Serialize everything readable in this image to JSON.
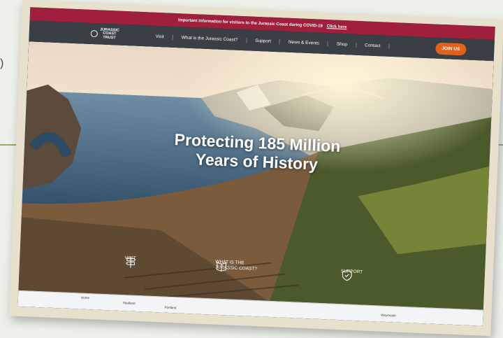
{
  "banner": {
    "notice": "Important information for visitors to the Jurassic Coast during COVID-19",
    "link": "Click here"
  },
  "logo": {
    "text": "JURASSIC\nCOAST\nTRUST"
  },
  "nav": {
    "items": [
      "Visit",
      "What is the Jurassic Coast?",
      "Support",
      "News & Events",
      "Shop",
      "Contact"
    ],
    "cta": "JOIN US"
  },
  "hero": {
    "headline": "Protecting 185 Million\nYears of History"
  },
  "quick_links": [
    {
      "label": "VISIT",
      "icon": "signpost-icon"
    },
    {
      "label": "WHAT IS THE\nJURASSIC COAST?",
      "icon": "book-icon"
    },
    {
      "label": "SUPPORT",
      "icon": "shield-icon"
    }
  ],
  "subnav": {
    "items": [
      "Home",
      "Studland",
      "Portland",
      "Weymouth"
    ]
  },
  "colors": {
    "banner": "#a01f3c",
    "nav": "#3a3f45",
    "cta": "#e0621d"
  }
}
